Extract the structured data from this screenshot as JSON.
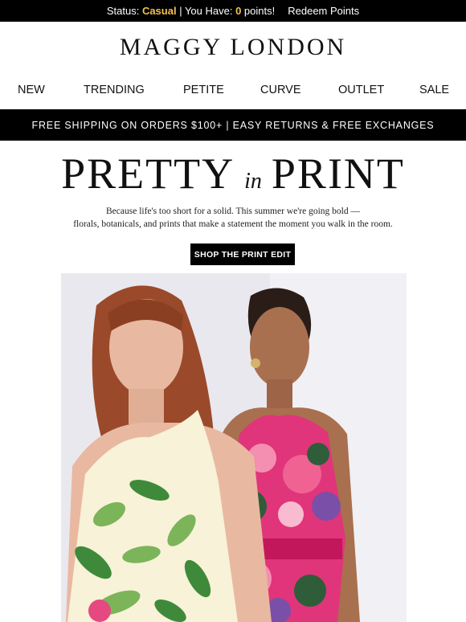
{
  "status_bar": {
    "status_label": "Status: ",
    "status_value": "Casual",
    "points_prefix": " | You Have: ",
    "points_value": "0",
    "points_suffix": " points!",
    "redeem_label": "Redeem Points",
    "highlight_color": "#f2c14e"
  },
  "brand": {
    "logo_text": "MAGGY LONDON"
  },
  "nav": {
    "items": [
      {
        "label": "NEW"
      },
      {
        "label": "TRENDING"
      },
      {
        "label": "PETITE"
      },
      {
        "label": "CURVE"
      },
      {
        "label": "OUTLET"
      },
      {
        "label": "SALE"
      }
    ]
  },
  "promo_bar": {
    "text": "FREE SHIPPING ON ORDERS $100+ | EASY RETURNS & FREE EXCHANGES"
  },
  "headline": {
    "part1": "PRETTY",
    "part2": "in",
    "part3": "PRINT"
  },
  "subcopy": {
    "line1": "Because life's too short for a solid. This summer we're going bold —",
    "line2": "florals, botanicals, and prints that make a statement the moment you walk in the room."
  },
  "cta": {
    "label": "SHOP THE PRINT EDIT"
  },
  "hero": {
    "description_icon": "model-photo",
    "background_color": "#e9e8ee",
    "dress1_colors": [
      "#f7f2d8",
      "#7cb45a",
      "#3f8a3a",
      "#e44a7f"
    ],
    "dress2_colors": [
      "#e0357a",
      "#f48fb1",
      "#2f5d3a",
      "#7a4fa8"
    ]
  }
}
